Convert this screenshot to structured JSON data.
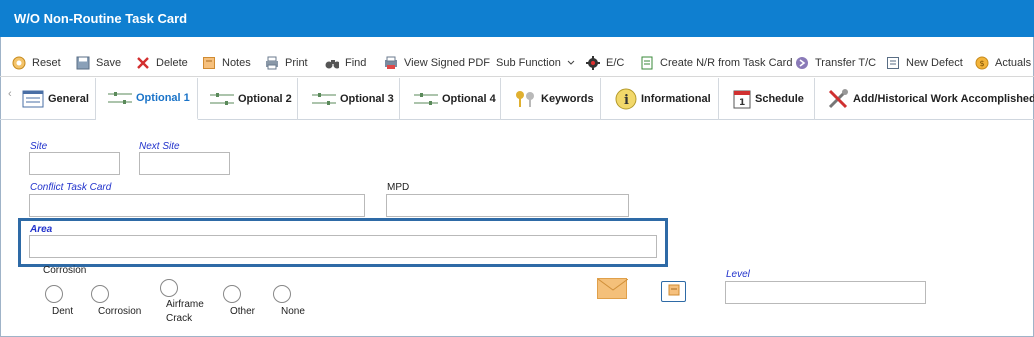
{
  "window": {
    "title": "W/O Non-Routine Task Card"
  },
  "toolbar": {
    "items": [
      {
        "label": "Reset",
        "icon": "reset-icon"
      },
      {
        "label": "Save",
        "icon": "save-icon"
      },
      {
        "label": "Delete",
        "icon": "delete-icon"
      },
      {
        "label": "Notes",
        "icon": "notes-icon"
      },
      {
        "label": "Print",
        "icon": "print-icon"
      },
      {
        "label": "Find",
        "icon": "binoculars-icon"
      },
      {
        "label": "View Signed PDF",
        "icon": "pdf-printer-icon"
      },
      {
        "label": "Sub Function",
        "icon": "chevron-down-icon"
      },
      {
        "label": "E/C",
        "icon": "gear-icon"
      },
      {
        "label": "Create N/R from Task Card",
        "icon": "document-icon"
      },
      {
        "label": "Transfer T/C",
        "icon": "transfer-icon"
      },
      {
        "label": "New Defect",
        "icon": "new-defect-icon"
      },
      {
        "label": "Actuals",
        "icon": "coin-icon"
      }
    ]
  },
  "tabs": [
    {
      "label": "General",
      "icon": "general-icon",
      "active": false
    },
    {
      "label": "Optional 1",
      "icon": "sliders-icon",
      "active": true
    },
    {
      "label": "Optional 2",
      "icon": "sliders-icon",
      "active": false
    },
    {
      "label": "Optional 3",
      "icon": "sliders-icon",
      "active": false
    },
    {
      "label": "Optional 4",
      "icon": "sliders-icon",
      "active": false
    },
    {
      "label": "Keywords",
      "icon": "keys-icon",
      "active": false
    },
    {
      "label": "Informational",
      "icon": "info-icon",
      "active": false
    },
    {
      "label": "Schedule",
      "icon": "calendar-icon",
      "active": false
    },
    {
      "label": "Add/Historical Work Accomplished",
      "icon": "tools-icon",
      "active": false
    }
  ],
  "form": {
    "site": {
      "label": "Site",
      "value": ""
    },
    "next_site": {
      "label": "Next Site",
      "value": ""
    },
    "conflict_task_card": {
      "label": "Conflict Task Card",
      "value": ""
    },
    "mpd": {
      "label": "MPD",
      "value": ""
    },
    "area": {
      "label": "Area",
      "value": ""
    },
    "corrosion": {
      "label": "Corrosion",
      "options": [
        {
          "label": "Dent"
        },
        {
          "label": "Corrosion"
        },
        {
          "label": "Airframe Crack",
          "line1": "Airframe",
          "line2": "Crack"
        },
        {
          "label": "Other"
        },
        {
          "label": "None"
        }
      ]
    },
    "level": {
      "label": "Level",
      "value": ""
    },
    "calendar_day": "1"
  },
  "colors": {
    "titlebar": "#0f7fd0",
    "active_tab_text": "#1a73c8",
    "field_label": "#2233cc",
    "highlight_border": "#2e6aa6"
  }
}
